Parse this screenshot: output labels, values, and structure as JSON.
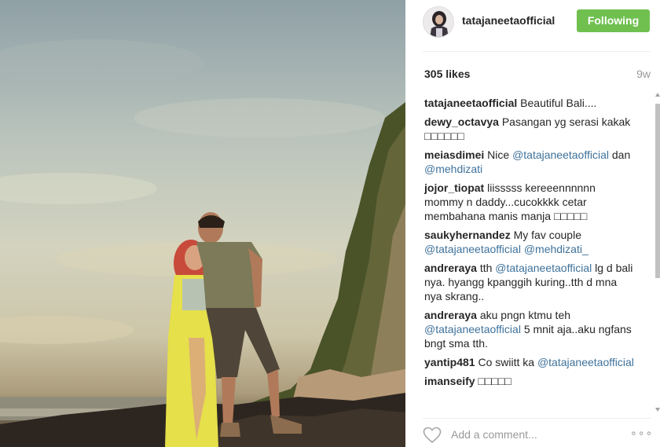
{
  "post": {
    "username": "tatajaneetaofficial",
    "follow_label": "Following",
    "likes": "305 likes",
    "time_ago": "9w",
    "add_comment_placeholder": "Add a comment...",
    "more_label": "∘∘∘"
  },
  "comments": [
    {
      "user": "tatajaneetaofficial",
      "parts": [
        {
          "t": "text",
          "v": "Beautiful Bali...."
        }
      ]
    },
    {
      "user": "dewy_octavya",
      "parts": [
        {
          "t": "text",
          "v": "Pasangan yg serasi kakak □□□□□□"
        }
      ]
    },
    {
      "user": "meiasdimei",
      "parts": [
        {
          "t": "text",
          "v": "Nice "
        },
        {
          "t": "mention",
          "v": "@tatajaneetaofficial"
        },
        {
          "t": "text",
          "v": " dan "
        },
        {
          "t": "mention",
          "v": "@mehdizati"
        }
      ]
    },
    {
      "user": "jojor_tiopat",
      "parts": [
        {
          "t": "text",
          "v": "liisssss kereeennnnnn mommy n daddy...cucokkkk cetar membahana manis manja □□□□□"
        }
      ]
    },
    {
      "user": "saukyhernandez",
      "parts": [
        {
          "t": "text",
          "v": "My fav couple "
        },
        {
          "t": "mention",
          "v": "@tatajaneetaofficial"
        },
        {
          "t": "text",
          "v": " "
        },
        {
          "t": "mention",
          "v": "@mehdizati_"
        }
      ]
    },
    {
      "user": "andreraya",
      "parts": [
        {
          "t": "text",
          "v": "tth "
        },
        {
          "t": "mention",
          "v": "@tatajaneetaofficial"
        },
        {
          "t": "text",
          "v": " lg d bali nya. hyangg kpanggih kuring..tth d mna nya skrang.."
        }
      ]
    },
    {
      "user": "andreraya",
      "parts": [
        {
          "t": "text",
          "v": "aku pngn ktmu teh "
        },
        {
          "t": "mention",
          "v": "@tatajaneetaofficial"
        },
        {
          "t": "text",
          "v": " 5 mnit aja..aku ngfans bngt sma tth."
        }
      ]
    },
    {
      "user": "yantip481",
      "parts": [
        {
          "t": "text",
          "v": "Co swiitt ka "
        },
        {
          "t": "mention",
          "v": "@tatajaneetaofficial"
        }
      ]
    },
    {
      "user": "imanseify",
      "parts": [
        {
          "t": "text",
          "v": "□□□□□"
        }
      ]
    }
  ],
  "icons": {
    "heart": "heart-icon",
    "more": "more-options-icon",
    "avatar": "profile-avatar"
  },
  "colors": {
    "follow_button": "#70c050",
    "mention": "#3f729b",
    "muted": "#999999",
    "text": "#262626"
  }
}
